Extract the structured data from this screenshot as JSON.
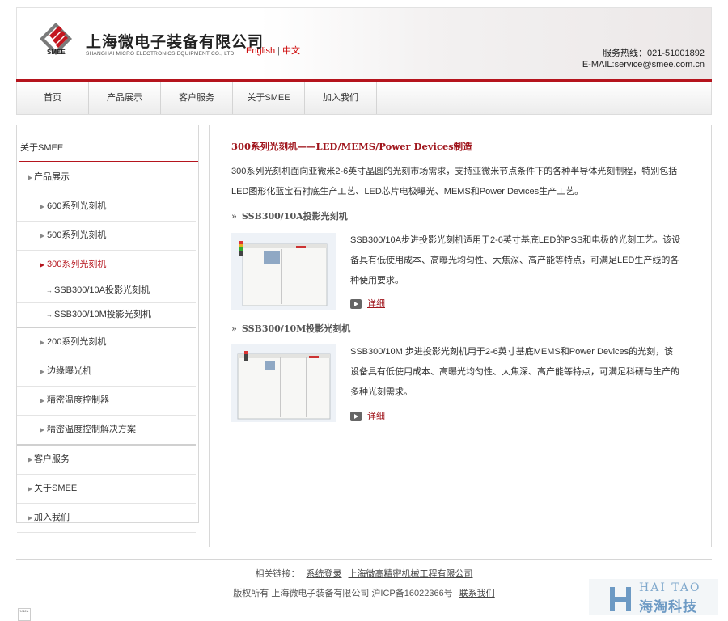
{
  "header": {
    "logo_cn": "上海微电子装备有限公司",
    "logo_en": "SHANGHAI MICRO ELECTRONICS EQUIPMENT CO., LTD.",
    "logo_short": "SMEE",
    "lang_en": "English",
    "lang_sep": "|",
    "lang_cn": "中文",
    "hotline": "服务热线：021-51001892",
    "email": "E-MAIL:service@smee.com.cn"
  },
  "nav": [
    "首页",
    "产品展示",
    "客户服务",
    "关于SMEE",
    "加入我们"
  ],
  "sidebar": {
    "title": "关于SMEE",
    "items": [
      {
        "label": "产品展示",
        "level": 1
      },
      {
        "label": "600系列光刻机",
        "level": 2
      },
      {
        "label": "500系列光刻机",
        "level": 2
      },
      {
        "label": "300系列光刻机",
        "level": 2,
        "active": true
      },
      {
        "label": "SSB300/10A投影光刻机",
        "level": 3
      },
      {
        "label": "SSB300/10M投影光刻机",
        "level": 3
      },
      {
        "label": "200系列光刻机",
        "level": 2
      },
      {
        "label": "边缘曝光机",
        "level": 2
      },
      {
        "label": "精密温度控制器",
        "level": 2
      },
      {
        "label": "精密温度控制解决方案",
        "level": 2
      },
      {
        "label": "客户服务",
        "level": 1
      },
      {
        "label": "关于SMEE",
        "level": 1
      },
      {
        "label": "加入我们",
        "level": 1
      }
    ]
  },
  "content": {
    "title": "300系列光刻机——LED/MEMS/Power Devices制造",
    "intro": "300系列光刻机面向亚微米2-6英寸晶圆的光刻市场需求，支持亚微米节点条件下的各种半导体光刻制程，特别包括LED图形化蓝宝石衬底生产工艺、LED芯片电极曝光、MEMS和Power Devices生产工艺。",
    "products": [
      {
        "name": "SSB300/10A投影光刻机",
        "desc": "SSB300/10A步进投影光刻机适用于2-6英寸基底LED的PSS和电极的光刻工艺。该设备具有低使用成本、高曝光均匀性、大焦深、高产能等特点，可满足LED生产线的各种使用要求。",
        "more": "详细"
      },
      {
        "name": "SSB300/10M投影光刻机",
        "desc": "SSB300/10M 步进投影光刻机用于2-6英寸基底MEMS和Power Devices的光刻，该设备具有低使用成本、高曝光均匀性、大焦深、高产能等特点，可满足科研与生产的多种光刻需求。",
        "more": "详细"
      }
    ]
  },
  "footer": {
    "links_label": "相关链接：",
    "link1": "系统登录",
    "link2": "上海微高精密机械工程有限公司",
    "copyright": "版权所有 上海微电子装备有限公司 沪ICP备16022366号",
    "contact": "联系我们",
    "cnzz": "CNZZ"
  },
  "watermark": {
    "en": "HAI TAO",
    "cn": "海淘科技"
  },
  "colors": {
    "brand_red": "#b5141d",
    "title_red": "#a0161d"
  }
}
